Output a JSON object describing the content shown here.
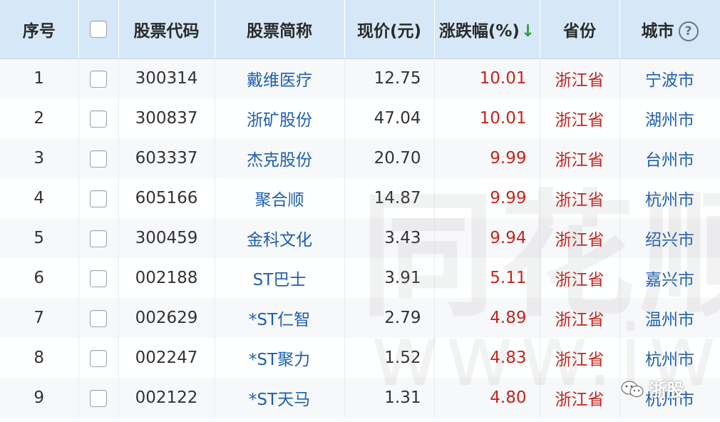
{
  "table": {
    "headers": {
      "index": "序号",
      "select": "",
      "code": "股票代码",
      "name": "股票简称",
      "price": "现价(元)",
      "change": "涨跌幅(%)",
      "sort_indicator": "↓",
      "province": "省份",
      "city": "城市",
      "help": "?"
    },
    "rows": [
      {
        "index": "1",
        "code": "300314",
        "name": "戴维医疗",
        "price": "12.75",
        "change": "10.01",
        "province": "浙江省",
        "city": "宁波市"
      },
      {
        "index": "2",
        "code": "300837",
        "name": "浙矿股份",
        "price": "47.04",
        "change": "10.01",
        "province": "浙江省",
        "city": "湖州市"
      },
      {
        "index": "3",
        "code": "603337",
        "name": "杰克股份",
        "price": "20.70",
        "change": "9.99",
        "province": "浙江省",
        "city": "台州市"
      },
      {
        "index": "4",
        "code": "605166",
        "name": "聚合顺",
        "price": "14.87",
        "change": "9.99",
        "province": "浙江省",
        "city": "杭州市"
      },
      {
        "index": "5",
        "code": "300459",
        "name": "金科文化",
        "price": "3.43",
        "change": "9.94",
        "province": "浙江省",
        "city": "绍兴市"
      },
      {
        "index": "6",
        "code": "002188",
        "name": "ST巴士",
        "price": "3.91",
        "change": "5.11",
        "province": "浙江省",
        "city": "嘉兴市"
      },
      {
        "index": "7",
        "code": "002629",
        "name": "*ST仁智",
        "price": "2.79",
        "change": "4.89",
        "province": "浙江省",
        "city": "温州市"
      },
      {
        "index": "8",
        "code": "002247",
        "name": "*ST聚力",
        "price": "1.52",
        "change": "4.83",
        "province": "浙江省",
        "city": "杭州市"
      },
      {
        "index": "9",
        "code": "002122",
        "name": "*ST天马",
        "price": "1.31",
        "change": "4.80",
        "province": "浙江省",
        "city": "杭州市"
      }
    ]
  },
  "watermark": {
    "brand": "同花顺",
    "url": "www.iwe"
  },
  "badge": {
    "icon": "wechat-icon",
    "text": "浙股"
  },
  "colors": {
    "header_bg": "#d6e8f7",
    "link_blue": "#1f5fb4",
    "up_red": "#c5251d",
    "sort_green": "#2f9b3a"
  }
}
